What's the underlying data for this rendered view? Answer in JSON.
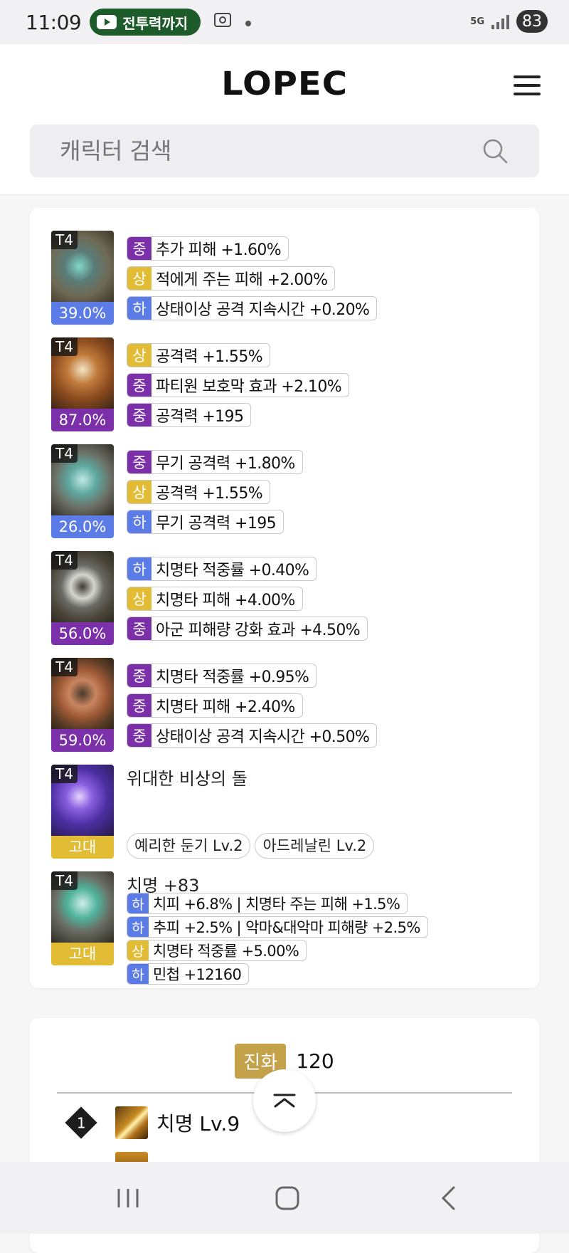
{
  "status_bar": {
    "time": "11:09",
    "notification": "전투력까지",
    "network": "5G",
    "battery": "83"
  },
  "header": {
    "logo": "LOPEC",
    "search": {
      "placeholder": "캐릭터 검색"
    }
  },
  "accessories": [
    {
      "tier": "T4",
      "quality": "39.0%",
      "quality_color": "blue",
      "effects": [
        {
          "grade": "중",
          "text": "추가 피해 +1.60%"
        },
        {
          "grade": "상",
          "text": "적에게 주는 피해 +2.00%"
        },
        {
          "grade": "하",
          "text": "상태이상 공격 지속시간 +0.20%"
        }
      ]
    },
    {
      "tier": "T4",
      "quality": "87.0%",
      "quality_color": "purple",
      "effects": [
        {
          "grade": "상",
          "text": "공격력 +1.55%"
        },
        {
          "grade": "중",
          "text": "파티원 보호막 효과 +2.10%"
        },
        {
          "grade": "중",
          "text": "공격력 +195"
        }
      ]
    },
    {
      "tier": "T4",
      "quality": "26.0%",
      "quality_color": "blue",
      "effects": [
        {
          "grade": "중",
          "text": "무기 공격력 +1.80%"
        },
        {
          "grade": "상",
          "text": "공격력 +1.55%"
        },
        {
          "grade": "하",
          "text": "무기 공격력 +195"
        }
      ]
    },
    {
      "tier": "T4",
      "quality": "56.0%",
      "quality_color": "purple",
      "effects": [
        {
          "grade": "하",
          "text": "치명타 적중률 +0.40%"
        },
        {
          "grade": "상",
          "text": "치명타 피해 +4.00%"
        },
        {
          "grade": "중",
          "text": "아군 피해량 강화 효과 +4.50%"
        }
      ]
    },
    {
      "tier": "T4",
      "quality": "59.0%",
      "quality_color": "purple",
      "effects": [
        {
          "grade": "중",
          "text": "치명타 적중률 +0.95%"
        },
        {
          "grade": "중",
          "text": "치명타 피해 +2.40%"
        },
        {
          "grade": "중",
          "text": "상태이상 공격 지속시간 +0.50%"
        }
      ]
    }
  ],
  "stone": {
    "tier": "T4",
    "grade": "고대",
    "name": "위대한 비상의 돌",
    "engravings": [
      "예리한 둔기 Lv.2",
      "아드레날린 Lv.2"
    ]
  },
  "bracelet": {
    "tier": "T4",
    "grade": "고대",
    "stat": "치명 +83",
    "effects": [
      {
        "grade": "하",
        "text": "치피 +6.8% | 치명타 주는 피해 +1.5%"
      },
      {
        "grade": "하",
        "text": "추피 +2.5% | 악마&대악마 피해량 +2.5%"
      },
      {
        "grade": "상",
        "text": "치명타 적중률 +5.00%"
      },
      {
        "grade": "하",
        "text": "민첩 +12160"
      }
    ]
  },
  "evolution": {
    "label": "진화",
    "value": "120",
    "nodes": [
      {
        "tier": "1",
        "name": "치명 Lv.9"
      }
    ]
  },
  "colors": {
    "grade_high": "#e2bc35",
    "grade_mid": "#7b2fa8",
    "grade_low": "#5b7be6",
    "evo_badge": "#c4a24a"
  }
}
